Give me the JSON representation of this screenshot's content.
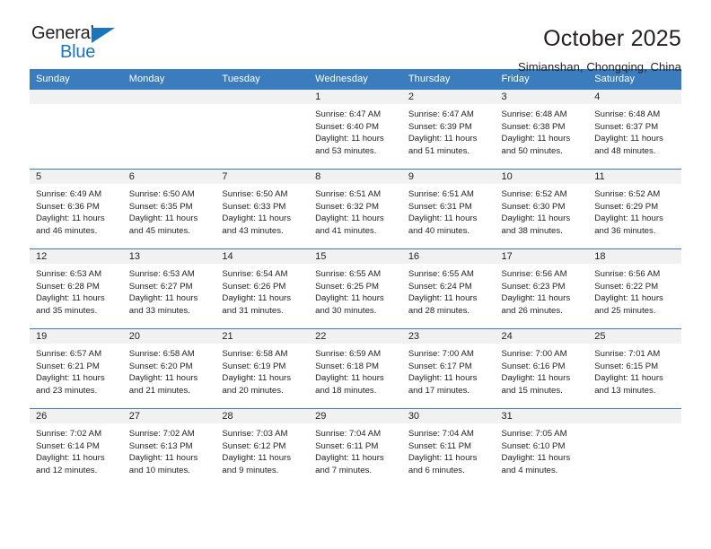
{
  "brand": {
    "name_top": "General",
    "name_bottom": "Blue",
    "triangle_color": "#1b75bb",
    "text_color": "#231f20"
  },
  "header": {
    "title": "October 2025",
    "location": "Simianshan, Chongqing, China"
  },
  "theme": {
    "header_bg": "#3a7cbe",
    "header_text": "#ffffff",
    "daynum_bg": "#f1f1f1",
    "body_text": "#231f20",
    "grid_line": "#3a7cbe"
  },
  "weekdays": [
    "Sunday",
    "Monday",
    "Tuesday",
    "Wednesday",
    "Thursday",
    "Friday",
    "Saturday"
  ],
  "labels": {
    "sunrise": "Sunrise:",
    "sunset": "Sunset:",
    "daylight": "Daylight:"
  },
  "weeks": [
    [
      {
        "day": "",
        "lines": []
      },
      {
        "day": "",
        "lines": []
      },
      {
        "day": "",
        "lines": []
      },
      {
        "day": "1",
        "lines": [
          "Sunrise: 6:47 AM",
          "Sunset: 6:40 PM",
          "Daylight: 11 hours and 53 minutes."
        ]
      },
      {
        "day": "2",
        "lines": [
          "Sunrise: 6:47 AM",
          "Sunset: 6:39 PM",
          "Daylight: 11 hours and 51 minutes."
        ]
      },
      {
        "day": "3",
        "lines": [
          "Sunrise: 6:48 AM",
          "Sunset: 6:38 PM",
          "Daylight: 11 hours and 50 minutes."
        ]
      },
      {
        "day": "4",
        "lines": [
          "Sunrise: 6:48 AM",
          "Sunset: 6:37 PM",
          "Daylight: 11 hours and 48 minutes."
        ]
      }
    ],
    [
      {
        "day": "5",
        "lines": [
          "Sunrise: 6:49 AM",
          "Sunset: 6:36 PM",
          "Daylight: 11 hours and 46 minutes."
        ]
      },
      {
        "day": "6",
        "lines": [
          "Sunrise: 6:50 AM",
          "Sunset: 6:35 PM",
          "Daylight: 11 hours and 45 minutes."
        ]
      },
      {
        "day": "7",
        "lines": [
          "Sunrise: 6:50 AM",
          "Sunset: 6:33 PM",
          "Daylight: 11 hours and 43 minutes."
        ]
      },
      {
        "day": "8",
        "lines": [
          "Sunrise: 6:51 AM",
          "Sunset: 6:32 PM",
          "Daylight: 11 hours and 41 minutes."
        ]
      },
      {
        "day": "9",
        "lines": [
          "Sunrise: 6:51 AM",
          "Sunset: 6:31 PM",
          "Daylight: 11 hours and 40 minutes."
        ]
      },
      {
        "day": "10",
        "lines": [
          "Sunrise: 6:52 AM",
          "Sunset: 6:30 PM",
          "Daylight: 11 hours and 38 minutes."
        ]
      },
      {
        "day": "11",
        "lines": [
          "Sunrise: 6:52 AM",
          "Sunset: 6:29 PM",
          "Daylight: 11 hours and 36 minutes."
        ]
      }
    ],
    [
      {
        "day": "12",
        "lines": [
          "Sunrise: 6:53 AM",
          "Sunset: 6:28 PM",
          "Daylight: 11 hours and 35 minutes."
        ]
      },
      {
        "day": "13",
        "lines": [
          "Sunrise: 6:53 AM",
          "Sunset: 6:27 PM",
          "Daylight: 11 hours and 33 minutes."
        ]
      },
      {
        "day": "14",
        "lines": [
          "Sunrise: 6:54 AM",
          "Sunset: 6:26 PM",
          "Daylight: 11 hours and 31 minutes."
        ]
      },
      {
        "day": "15",
        "lines": [
          "Sunrise: 6:55 AM",
          "Sunset: 6:25 PM",
          "Daylight: 11 hours and 30 minutes."
        ]
      },
      {
        "day": "16",
        "lines": [
          "Sunrise: 6:55 AM",
          "Sunset: 6:24 PM",
          "Daylight: 11 hours and 28 minutes."
        ]
      },
      {
        "day": "17",
        "lines": [
          "Sunrise: 6:56 AM",
          "Sunset: 6:23 PM",
          "Daylight: 11 hours and 26 minutes."
        ]
      },
      {
        "day": "18",
        "lines": [
          "Sunrise: 6:56 AM",
          "Sunset: 6:22 PM",
          "Daylight: 11 hours and 25 minutes."
        ]
      }
    ],
    [
      {
        "day": "19",
        "lines": [
          "Sunrise: 6:57 AM",
          "Sunset: 6:21 PM",
          "Daylight: 11 hours and 23 minutes."
        ]
      },
      {
        "day": "20",
        "lines": [
          "Sunrise: 6:58 AM",
          "Sunset: 6:20 PM",
          "Daylight: 11 hours and 21 minutes."
        ]
      },
      {
        "day": "21",
        "lines": [
          "Sunrise: 6:58 AM",
          "Sunset: 6:19 PM",
          "Daylight: 11 hours and 20 minutes."
        ]
      },
      {
        "day": "22",
        "lines": [
          "Sunrise: 6:59 AM",
          "Sunset: 6:18 PM",
          "Daylight: 11 hours and 18 minutes."
        ]
      },
      {
        "day": "23",
        "lines": [
          "Sunrise: 7:00 AM",
          "Sunset: 6:17 PM",
          "Daylight: 11 hours and 17 minutes."
        ]
      },
      {
        "day": "24",
        "lines": [
          "Sunrise: 7:00 AM",
          "Sunset: 6:16 PM",
          "Daylight: 11 hours and 15 minutes."
        ]
      },
      {
        "day": "25",
        "lines": [
          "Sunrise: 7:01 AM",
          "Sunset: 6:15 PM",
          "Daylight: 11 hours and 13 minutes."
        ]
      }
    ],
    [
      {
        "day": "26",
        "lines": [
          "Sunrise: 7:02 AM",
          "Sunset: 6:14 PM",
          "Daylight: 11 hours and 12 minutes."
        ]
      },
      {
        "day": "27",
        "lines": [
          "Sunrise: 7:02 AM",
          "Sunset: 6:13 PM",
          "Daylight: 11 hours and 10 minutes."
        ]
      },
      {
        "day": "28",
        "lines": [
          "Sunrise: 7:03 AM",
          "Sunset: 6:12 PM",
          "Daylight: 11 hours and 9 minutes."
        ]
      },
      {
        "day": "29",
        "lines": [
          "Sunrise: 7:04 AM",
          "Sunset: 6:11 PM",
          "Daylight: 11 hours and 7 minutes."
        ]
      },
      {
        "day": "30",
        "lines": [
          "Sunrise: 7:04 AM",
          "Sunset: 6:11 PM",
          "Daylight: 11 hours and 6 minutes."
        ]
      },
      {
        "day": "31",
        "lines": [
          "Sunrise: 7:05 AM",
          "Sunset: 6:10 PM",
          "Daylight: 11 hours and 4 minutes."
        ]
      },
      {
        "day": "",
        "lines": []
      }
    ]
  ]
}
